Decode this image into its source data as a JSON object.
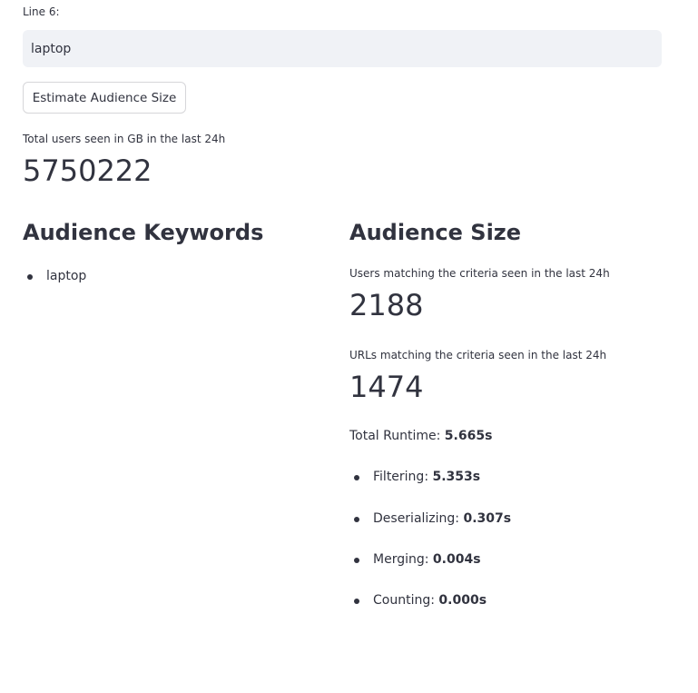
{
  "input": {
    "label": "Line 6:",
    "value": "laptop"
  },
  "estimate_button_label": "Estimate Audience Size",
  "total_users": {
    "label": "Total users seen in GB in the last 24h",
    "value": "5750222"
  },
  "keywords_section": {
    "heading": "Audience Keywords",
    "items": [
      "laptop"
    ]
  },
  "size_section": {
    "heading": "Audience Size",
    "users_metric": {
      "label": "Users matching the criteria seen in the last 24h",
      "value": "2188"
    },
    "urls_metric": {
      "label": "URLs matching the criteria seen in the last 24h",
      "value": "1474"
    },
    "runtime": {
      "label": "Total Runtime:",
      "value": "5.665s"
    },
    "steps": [
      {
        "label": "Filtering:",
        "value": "5.353s"
      },
      {
        "label": "Deserializing:",
        "value": "0.307s"
      },
      {
        "label": "Merging:",
        "value": "0.004s"
      },
      {
        "label": "Counting:",
        "value": "0.000s"
      }
    ]
  }
}
